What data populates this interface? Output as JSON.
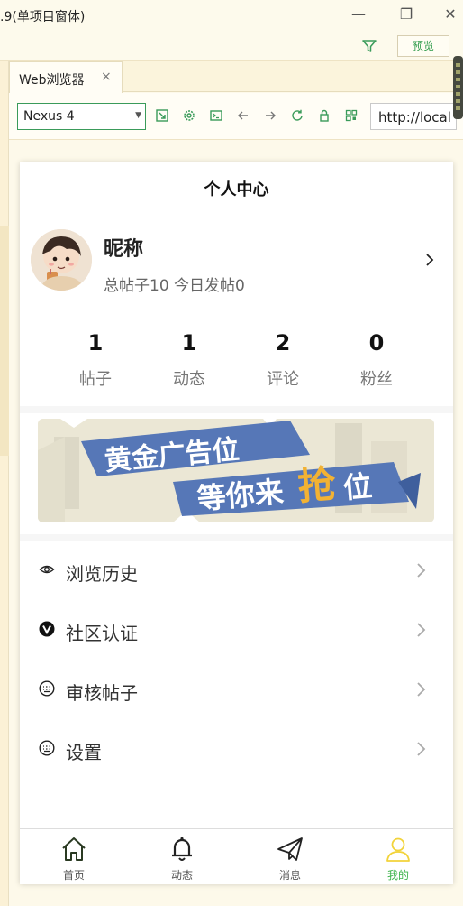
{
  "window": {
    "title": ".9(单项目窗体)",
    "minimize_glyph": "—",
    "maximize_glyph": "❐",
    "close_glyph": "✕"
  },
  "toolbar": {
    "filter_icon": "filter-icon",
    "preview_label": "预览"
  },
  "tabs": [
    {
      "label": "Web浏览器",
      "close": "×"
    }
  ],
  "device_bar": {
    "device": "Nexus 4",
    "url": "http://local"
  },
  "app": {
    "header_title": "个人中心",
    "profile": {
      "nickname": "昵称",
      "stats_line": "总帖子10 今日发帖0"
    },
    "counts": [
      {
        "value": "1",
        "label": "帖子"
      },
      {
        "value": "1",
        "label": "动态"
      },
      {
        "value": "2",
        "label": "评论"
      },
      {
        "value": "0",
        "label": "粉丝"
      }
    ],
    "banner": {
      "line1": "黄金广告位",
      "line2_a": "等你来",
      "line2_b": "抢",
      "line2_c": "位"
    },
    "menu": [
      {
        "label": "浏览历史",
        "icon": "eye-icon"
      },
      {
        "label": "社区认证",
        "icon": "verified-v-icon"
      },
      {
        "label": "审核帖子",
        "icon": "keyboard-icon"
      },
      {
        "label": "设置",
        "icon": "keyboard-icon"
      }
    ],
    "tabbar": [
      {
        "label": "首页",
        "icon": "home-icon"
      },
      {
        "label": "动态",
        "icon": "bell-icon"
      },
      {
        "label": "消息",
        "icon": "paper-plane-icon"
      },
      {
        "label": "我的",
        "icon": "user-icon",
        "active": true
      }
    ],
    "active_color": "#3cb34a",
    "banner_gold": "#f2b233",
    "banner_blue": "#5677b7"
  }
}
